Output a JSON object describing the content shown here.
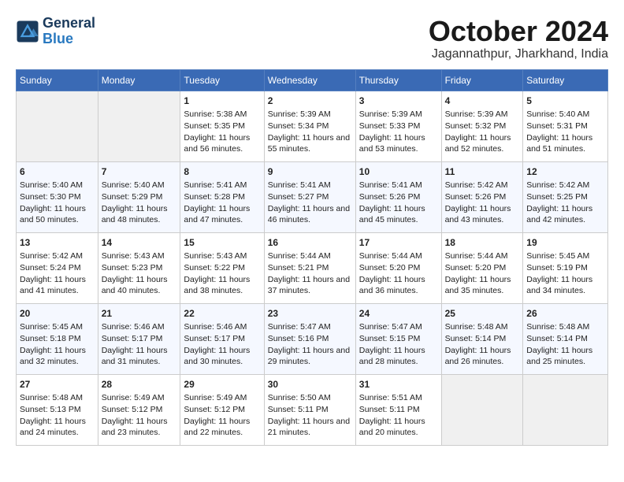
{
  "header": {
    "logo_line1": "General",
    "logo_line2": "Blue",
    "month": "October 2024",
    "location": "Jagannathpur, Jharkhand, India"
  },
  "days_of_week": [
    "Sunday",
    "Monday",
    "Tuesday",
    "Wednesday",
    "Thursday",
    "Friday",
    "Saturday"
  ],
  "weeks": [
    [
      {
        "day": "",
        "content": ""
      },
      {
        "day": "",
        "content": ""
      },
      {
        "day": "1",
        "content": "Sunrise: 5:38 AM\nSunset: 5:35 PM\nDaylight: 11 hours and 56 minutes."
      },
      {
        "day": "2",
        "content": "Sunrise: 5:39 AM\nSunset: 5:34 PM\nDaylight: 11 hours and 55 minutes."
      },
      {
        "day": "3",
        "content": "Sunrise: 5:39 AM\nSunset: 5:33 PM\nDaylight: 11 hours and 53 minutes."
      },
      {
        "day": "4",
        "content": "Sunrise: 5:39 AM\nSunset: 5:32 PM\nDaylight: 11 hours and 52 minutes."
      },
      {
        "day": "5",
        "content": "Sunrise: 5:40 AM\nSunset: 5:31 PM\nDaylight: 11 hours and 51 minutes."
      }
    ],
    [
      {
        "day": "6",
        "content": "Sunrise: 5:40 AM\nSunset: 5:30 PM\nDaylight: 11 hours and 50 minutes."
      },
      {
        "day": "7",
        "content": "Sunrise: 5:40 AM\nSunset: 5:29 PM\nDaylight: 11 hours and 48 minutes."
      },
      {
        "day": "8",
        "content": "Sunrise: 5:41 AM\nSunset: 5:28 PM\nDaylight: 11 hours and 47 minutes."
      },
      {
        "day": "9",
        "content": "Sunrise: 5:41 AM\nSunset: 5:27 PM\nDaylight: 11 hours and 46 minutes."
      },
      {
        "day": "10",
        "content": "Sunrise: 5:41 AM\nSunset: 5:26 PM\nDaylight: 11 hours and 45 minutes."
      },
      {
        "day": "11",
        "content": "Sunrise: 5:42 AM\nSunset: 5:26 PM\nDaylight: 11 hours and 43 minutes."
      },
      {
        "day": "12",
        "content": "Sunrise: 5:42 AM\nSunset: 5:25 PM\nDaylight: 11 hours and 42 minutes."
      }
    ],
    [
      {
        "day": "13",
        "content": "Sunrise: 5:42 AM\nSunset: 5:24 PM\nDaylight: 11 hours and 41 minutes."
      },
      {
        "day": "14",
        "content": "Sunrise: 5:43 AM\nSunset: 5:23 PM\nDaylight: 11 hours and 40 minutes."
      },
      {
        "day": "15",
        "content": "Sunrise: 5:43 AM\nSunset: 5:22 PM\nDaylight: 11 hours and 38 minutes."
      },
      {
        "day": "16",
        "content": "Sunrise: 5:44 AM\nSunset: 5:21 PM\nDaylight: 11 hours and 37 minutes."
      },
      {
        "day": "17",
        "content": "Sunrise: 5:44 AM\nSunset: 5:20 PM\nDaylight: 11 hours and 36 minutes."
      },
      {
        "day": "18",
        "content": "Sunrise: 5:44 AM\nSunset: 5:20 PM\nDaylight: 11 hours and 35 minutes."
      },
      {
        "day": "19",
        "content": "Sunrise: 5:45 AM\nSunset: 5:19 PM\nDaylight: 11 hours and 34 minutes."
      }
    ],
    [
      {
        "day": "20",
        "content": "Sunrise: 5:45 AM\nSunset: 5:18 PM\nDaylight: 11 hours and 32 minutes."
      },
      {
        "day": "21",
        "content": "Sunrise: 5:46 AM\nSunset: 5:17 PM\nDaylight: 11 hours and 31 minutes."
      },
      {
        "day": "22",
        "content": "Sunrise: 5:46 AM\nSunset: 5:17 PM\nDaylight: 11 hours and 30 minutes."
      },
      {
        "day": "23",
        "content": "Sunrise: 5:47 AM\nSunset: 5:16 PM\nDaylight: 11 hours and 29 minutes."
      },
      {
        "day": "24",
        "content": "Sunrise: 5:47 AM\nSunset: 5:15 PM\nDaylight: 11 hours and 28 minutes."
      },
      {
        "day": "25",
        "content": "Sunrise: 5:48 AM\nSunset: 5:14 PM\nDaylight: 11 hours and 26 minutes."
      },
      {
        "day": "26",
        "content": "Sunrise: 5:48 AM\nSunset: 5:14 PM\nDaylight: 11 hours and 25 minutes."
      }
    ],
    [
      {
        "day": "27",
        "content": "Sunrise: 5:48 AM\nSunset: 5:13 PM\nDaylight: 11 hours and 24 minutes."
      },
      {
        "day": "28",
        "content": "Sunrise: 5:49 AM\nSunset: 5:12 PM\nDaylight: 11 hours and 23 minutes."
      },
      {
        "day": "29",
        "content": "Sunrise: 5:49 AM\nSunset: 5:12 PM\nDaylight: 11 hours and 22 minutes."
      },
      {
        "day": "30",
        "content": "Sunrise: 5:50 AM\nSunset: 5:11 PM\nDaylight: 11 hours and 21 minutes."
      },
      {
        "day": "31",
        "content": "Sunrise: 5:51 AM\nSunset: 5:11 PM\nDaylight: 11 hours and 20 minutes."
      },
      {
        "day": "",
        "content": ""
      },
      {
        "day": "",
        "content": ""
      }
    ]
  ]
}
